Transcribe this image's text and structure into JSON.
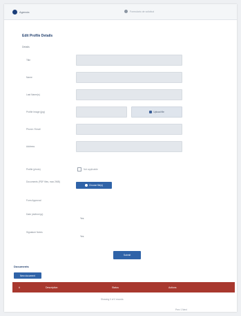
{
  "header": {
    "logo_text": "Agencia",
    "center_text": "Formulario de solicitud"
  },
  "form": {
    "title": "Edit Profile Details",
    "section_label": "Details",
    "rows": [
      {
        "label": "Title"
      },
      {
        "label": "Name"
      },
      {
        "label": "Last Name(s)"
      },
      {
        "label": "Profile Image (jpg)",
        "button": "Upload file"
      },
      {
        "label": "Phone / Email"
      },
      {
        "label": "Address"
      },
      {
        "label": "Profile (photo)",
        "checkbox": "Not applicable"
      },
      {
        "label": "Documents (PDF files, max 2MB)",
        "button": "Choose file(s)"
      },
      {
        "label": "Form Approval"
      },
      {
        "label": "Date (dd/mm/yy)",
        "value": "Yes"
      },
      {
        "label": "Signature Notes",
        "value": "Yes"
      }
    ],
    "submit_label": "Submit"
  },
  "list": {
    "title": "Documents",
    "new_button": "New document",
    "columns": [
      "#",
      "Description",
      "Status",
      "Actions"
    ],
    "footer_text": "Showing 0 of 0 records",
    "pager_text": "Prev  1  Next"
  },
  "colors": {
    "brand": "#1c3f7a",
    "accent": "#2f63a8",
    "table_header": "#a8382e"
  }
}
